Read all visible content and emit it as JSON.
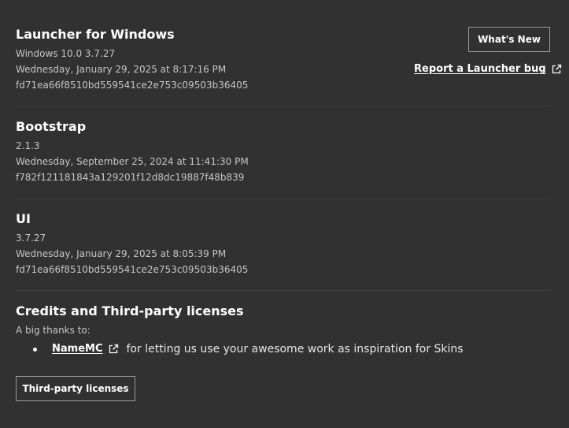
{
  "launcher": {
    "title": "Launcher for Windows",
    "version": "Windows 10.0 3.7.27",
    "date": "Wednesday, January 29, 2025 at 8:17:16 PM",
    "hash": "fd71ea66f8510bd559541ce2e753c09503b36405"
  },
  "whats_new_label": "What's New",
  "report_bug_label": "Report a Launcher bug",
  "bootstrap": {
    "title": "Bootstrap",
    "version": "2.1.3",
    "date": "Wednesday, September 25, 2024 at 11:41:30 PM",
    "hash": "f782f121181843a129201f12d8dc19887f48b839"
  },
  "ui": {
    "title": "UI",
    "version": "3.7.27",
    "date": "Wednesday, January 29, 2025 at 8:05:39 PM",
    "hash": "fd71ea66f8510bd559541ce2e753c09503b36405"
  },
  "credits": {
    "title": "Credits and Third-party licenses",
    "thanks": "A big thanks to:",
    "items": [
      {
        "link": "NameMC",
        "text": "for letting us use your awesome work as inspiration for Skins"
      }
    ],
    "licenses_button": "Third-party licenses"
  },
  "icons": {
    "external": "external-link-icon"
  },
  "colors": {
    "background": "#313131",
    "divider": "#3f3f3f",
    "secondary_text": "#c6c6c6",
    "button_border": "#9a9a9a"
  }
}
